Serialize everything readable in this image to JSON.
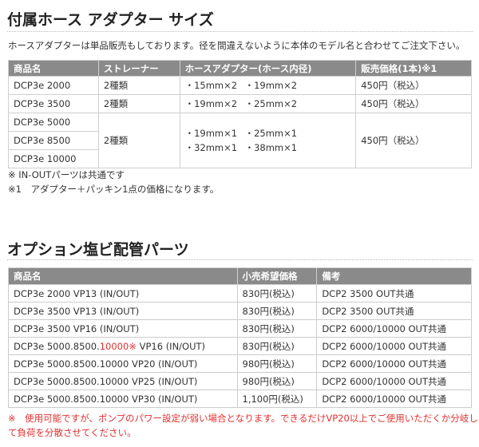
{
  "section1": {
    "title": "付属ホース アダプター サイズ",
    "intro": "ホースアダプターは単品販売もしております。径を間違えないように本体のモデル名と合わせてご注文下さい。",
    "headers": [
      "商品名",
      "ストレーナー",
      "ホースアダプター(ホース内径)",
      "販売価格(1本)※1"
    ],
    "rows": [
      {
        "model": "DCP3e 2000",
        "strainer": "2種類",
        "hose": [
          "・15mm×2",
          "・19mm×2"
        ],
        "price": "450円（税込）"
      },
      {
        "model": "DCP3e 3500",
        "strainer": "2種類",
        "hose": [
          "・19mm×2",
          "・25mm×2"
        ],
        "price": "450円（税込）"
      }
    ],
    "group": {
      "models": [
        "DCP3e 5000",
        "DCP3e 8500",
        "DCP3e 10000"
      ],
      "strainer": "2種類",
      "hose_lines": [
        [
          "・19mm×1",
          "・25mm×1"
        ],
        [
          "・32mm×1",
          "・38mm×1"
        ]
      ],
      "price": "450円（税込）"
    },
    "notes": [
      "※ IN-OUTパーツは共通です",
      "※1　アダプター＋パッキン1点の価格になります。"
    ]
  },
  "section2": {
    "title": "オプション塩ビ配管パーツ",
    "headers": [
      "商品名",
      "小売希望価格",
      "備考"
    ],
    "rows": [
      {
        "name": "DCP3e 2000 VP13 (IN/OUT)",
        "price": "830円(税込)",
        "note": "DCP2 3500 OUT共通"
      },
      {
        "name": "DCP3e 3500 VP13 (IN/OUT)",
        "price": "830円(税込)",
        "note": "DCP2 3500 OUT共通"
      },
      {
        "name": "DCP3e 3500 VP16 (IN/OUT)",
        "price": "830円(税込)",
        "note": "DCP2 6000/10000 OUT共通"
      },
      {
        "name_parts": [
          "DCP3e 5000.8500.",
          "10000※",
          " VP16 (IN/OUT)"
        ],
        "price": "830円(税込)",
        "note": "DCP2 6000/10000 OUT共通"
      },
      {
        "name": "DCP3e 5000.8500.10000 VP20 (IN/OUT)",
        "price": "980円(税込)",
        "note": "DCP2 6000/10000 OUT共通"
      },
      {
        "name": "DCP3e 5000.8500.10000 VP25 (IN/OUT)",
        "price": "980円(税込)",
        "note": "DCP2 6000/10000 OUT共通"
      },
      {
        "name": "DCP3e 5000.8500.10000 VP30 (IN/OUT)",
        "price": "1,100円(税込)",
        "note": "DCP2 6000/10000 OUT共通"
      }
    ],
    "warning": [
      "※　使用可能ですが、ポンプのパワー設定が弱い場合となります。できるだけVP20以上でご使用いただくか分岐し",
      "て負荷を分散させてください。"
    ]
  },
  "colors": {
    "header_bg": "#8a8a8a",
    "warning": "#e03030"
  }
}
